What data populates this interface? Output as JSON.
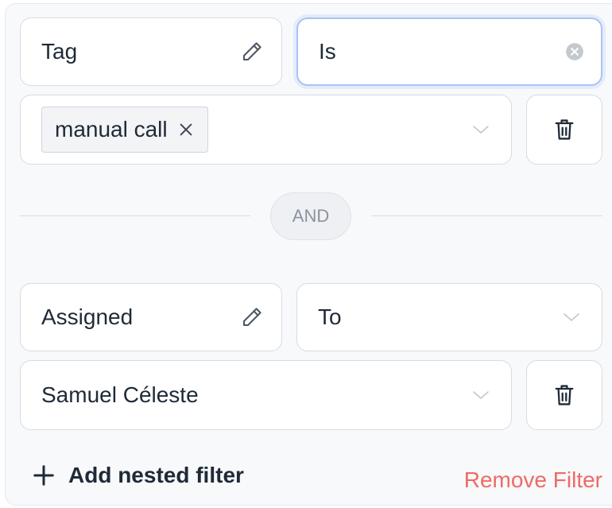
{
  "condition_1": {
    "field_label": "Tag",
    "operator_value": "Is",
    "selected_tags": [
      "manual call"
    ]
  },
  "joiner_label": "AND",
  "condition_2": {
    "field_label": "Assigned",
    "operator_value": "To",
    "selected_value": "Samuel Céleste"
  },
  "footer": {
    "add_nested_label": "Add nested filter",
    "remove_filter_label": "Remove Filter"
  },
  "icons": {
    "edit": "pencil-icon",
    "clear": "clear-circle-icon",
    "chevron": "chevron-down-icon",
    "remove_chip": "close-icon",
    "delete": "trash-icon",
    "add": "plus-icon"
  },
  "colors": {
    "focus_border": "#a8c3f3",
    "danger_text": "#ef6a64",
    "chip_bg": "#f3f4f6",
    "panel_bg": "#f8f9fb"
  }
}
